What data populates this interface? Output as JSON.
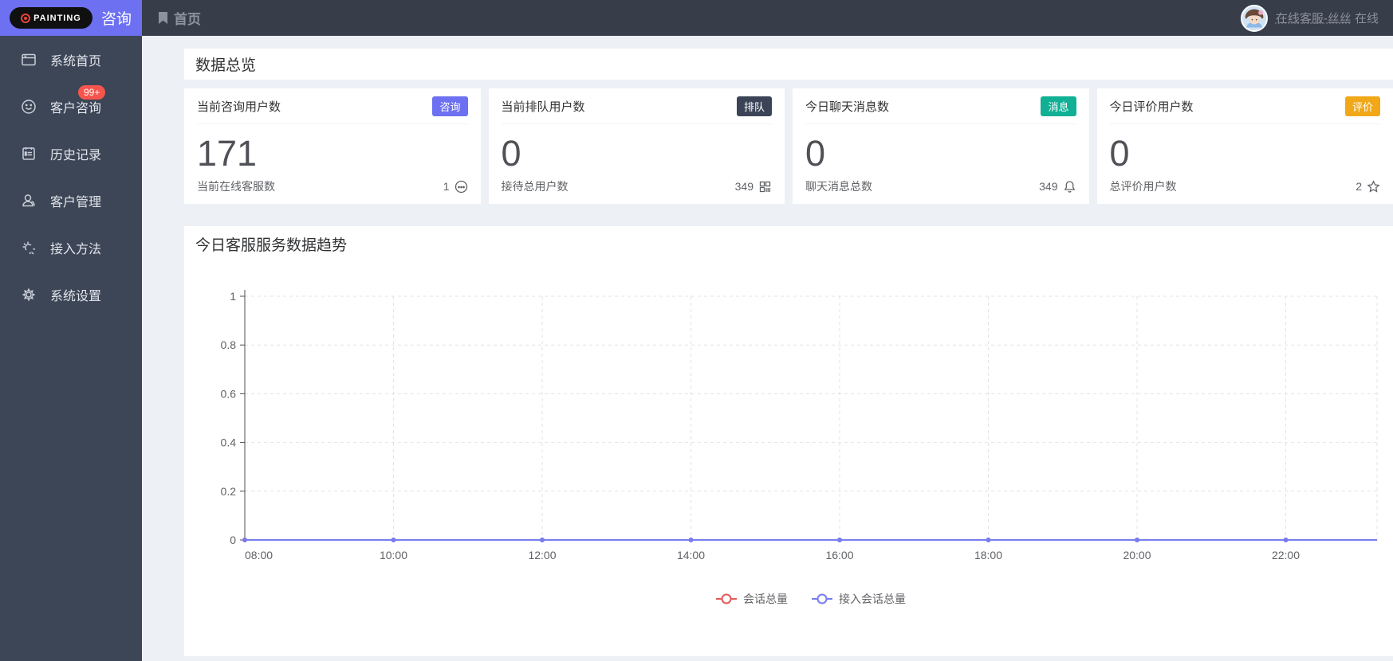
{
  "brand": {
    "logo_text": "PAINTING",
    "product": "咨询"
  },
  "topbar": {
    "home_tab": "首页",
    "user_name": "在线客服-丝丝",
    "user_state": "在线"
  },
  "sidebar": {
    "items": [
      {
        "label": "系统首页",
        "icon": "window-icon"
      },
      {
        "label": "客户咨询",
        "icon": "smiley-icon",
        "badge": "99+"
      },
      {
        "label": "历史记录",
        "icon": "notebook-icon"
      },
      {
        "label": "客户管理",
        "icon": "user-icon"
      },
      {
        "label": "接入方法",
        "icon": "spark-icon"
      },
      {
        "label": "系统设置",
        "icon": "gear-icon"
      }
    ]
  },
  "overview": {
    "title": "数据总览",
    "cards": [
      {
        "title": "当前咨询用户数",
        "badge": "咨询",
        "badge_color": "#6c70f1",
        "value": "171",
        "footer_label": "当前在线客服数",
        "footer_value": "1",
        "footer_icon": "face-icon"
      },
      {
        "title": "当前排队用户数",
        "badge": "排队",
        "badge_color": "#3b4357",
        "value": "0",
        "footer_label": "接待总用户数",
        "footer_value": "349",
        "footer_icon": "grid-icon"
      },
      {
        "title": "今日聊天消息数",
        "badge": "消息",
        "badge_color": "#11b095",
        "value": "0",
        "footer_label": "聊天消息总数",
        "footer_value": "349",
        "footer_icon": "bell-icon"
      },
      {
        "title": "今日评价用户数",
        "badge": "评价",
        "badge_color": "#f0a818",
        "value": "0",
        "footer_label": "总评价用户数",
        "footer_value": "2",
        "footer_icon": "star-icon"
      }
    ]
  },
  "trend": {
    "title": "今日客服服务数据趋势"
  },
  "chart_data": {
    "type": "line",
    "title": "今日客服服务数据趋势",
    "x": [
      "08:00",
      "10:00",
      "12:00",
      "14:00",
      "16:00",
      "18:00",
      "20:00",
      "22:00"
    ],
    "series": [
      {
        "name": "会话总量",
        "color": "#e25a5a",
        "values": [
          0,
          0,
          0,
          0,
          0,
          0,
          0,
          0
        ]
      },
      {
        "name": "接入会话总量",
        "color": "#767df0",
        "values": [
          0,
          0,
          0,
          0,
          0,
          0,
          0,
          0
        ]
      }
    ],
    "ylim": [
      0,
      1
    ],
    "yticks": [
      0,
      0.2,
      0.4,
      0.6,
      0.8,
      1
    ],
    "grid": true,
    "legend_position": "bottom",
    "colors": {
      "axis": "#4d4d4d",
      "grid": "#e0e3e9",
      "tick_label": "#606266"
    }
  }
}
